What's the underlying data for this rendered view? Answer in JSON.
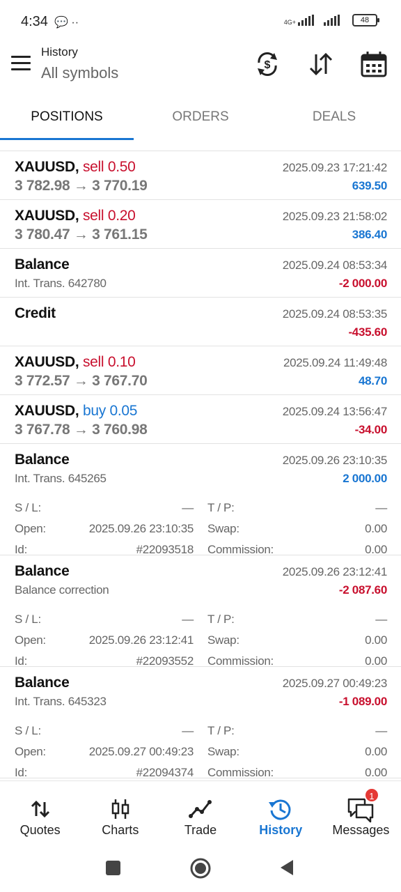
{
  "status_bar": {
    "time": "4:34",
    "left_icons": "💬 ··",
    "network_label": "4G+",
    "battery": "48"
  },
  "header": {
    "title": "History",
    "subtitle": "All symbols",
    "icons": [
      "menu-icon",
      "currency-exchange-icon",
      "sort-icon",
      "calendar-icon"
    ]
  },
  "tabs": [
    {
      "label": "POSITIONS",
      "active": true
    },
    {
      "label": "ORDERS",
      "active": false
    },
    {
      "label": "DEALS",
      "active": false
    }
  ],
  "rows": [
    {
      "symbol": "XAUUSD,",
      "type": "sell 0.50",
      "direction": "sell",
      "prices": "3 782.98 → 3 770.19",
      "time": "2025.09.23 17:21:42",
      "profit": "639.50",
      "profit_sign": "pos"
    },
    {
      "symbol": "XAUUSD,",
      "type": "sell 0.20",
      "direction": "sell",
      "prices": "3 780.47 → 3 761.15",
      "time": "2025.09.23 21:58:02",
      "profit": "386.40",
      "profit_sign": "pos"
    },
    {
      "symbol": "Balance",
      "comment": "Int. Trans. 642780",
      "time": "2025.09.24 08:53:34",
      "profit": "-2 000.00",
      "profit_sign": "neg"
    },
    {
      "symbol": "Credit",
      "comment": "",
      "time": "2025.09.24 08:53:35",
      "profit": "-435.60",
      "profit_sign": "neg"
    },
    {
      "symbol": "XAUUSD,",
      "type": "sell 0.10",
      "direction": "sell",
      "prices": "3 772.57 → 3 767.70",
      "time": "2025.09.24 11:49:48",
      "profit": "48.70",
      "profit_sign": "pos"
    },
    {
      "symbol": "XAUUSD,",
      "type": "buy 0.05",
      "direction": "buy",
      "prices": "3 767.78 → 3 760.98",
      "time": "2025.09.24 13:56:47",
      "profit": "-34.00",
      "profit_sign": "neg"
    },
    {
      "symbol": "Balance",
      "comment": "Int. Trans. 645265",
      "time": "2025.09.26 23:10:35",
      "profit": "2 000.00",
      "profit_sign": "pos",
      "details": {
        "sl_label": "S / L:",
        "sl": "—",
        "tp_label": "T / P:",
        "tp": "—",
        "open_label": "Open:",
        "open": "2025.09.26 23:10:35",
        "swap_label": "Swap:",
        "swap": "0.00",
        "id_label": "Id:",
        "id": "#22093518",
        "commission_label": "Commission:",
        "commission": "0.00"
      }
    },
    {
      "symbol": "Balance",
      "comment": "Balance correction",
      "time": "2025.09.26 23:12:41",
      "profit": "-2 087.60",
      "profit_sign": "neg",
      "details": {
        "sl_label": "S / L:",
        "sl": "—",
        "tp_label": "T / P:",
        "tp": "—",
        "open_label": "Open:",
        "open": "2025.09.26 23:12:41",
        "swap_label": "Swap:",
        "swap": "0.00",
        "id_label": "Id:",
        "id": "#22093552",
        "commission_label": "Commission:",
        "commission": "0.00"
      }
    },
    {
      "symbol": "Balance",
      "comment": "Int. Trans. 645323",
      "time": "2025.09.27 00:49:23",
      "profit": "-1 089.00",
      "profit_sign": "neg",
      "details": {
        "sl_label": "S / L:",
        "sl": "—",
        "tp_label": "T / P:",
        "tp": "—",
        "open_label": "Open:",
        "open": "2025.09.27 00:49:23",
        "swap_label": "Swap:",
        "swap": "0.00",
        "id_label": "Id:",
        "id": "#22094374",
        "commission_label": "Commission:",
        "commission": "0.00"
      }
    }
  ],
  "bottom_nav": [
    {
      "label": "Quotes",
      "icon": "quotes-arrows-icon",
      "active": false
    },
    {
      "label": "Charts",
      "icon": "candlestick-icon",
      "active": false
    },
    {
      "label": "Trade",
      "icon": "trade-line-icon",
      "active": false
    },
    {
      "label": "History",
      "icon": "history-clock-icon",
      "active": true
    },
    {
      "label": "Messages",
      "icon": "messages-icon",
      "active": false,
      "badge": "1"
    }
  ],
  "colors": {
    "accent": "#1976d2",
    "negative": "#c8102e"
  }
}
